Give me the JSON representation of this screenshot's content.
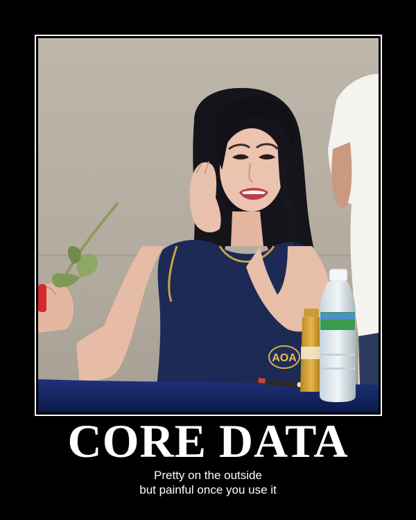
{
  "poster": {
    "title": "CORE DATA",
    "caption_lines": [
      "Pretty on the outside",
      "but painful once you use it"
    ]
  },
  "photo": {
    "jersey_text": "AOA"
  },
  "colors": {
    "background": "#000000",
    "frame_border": "#ffffff",
    "text": "#ffffff",
    "wall": "#b9b2a6",
    "table": "#12235e",
    "jersey": "#1c2a55",
    "hair": "#14131a"
  }
}
